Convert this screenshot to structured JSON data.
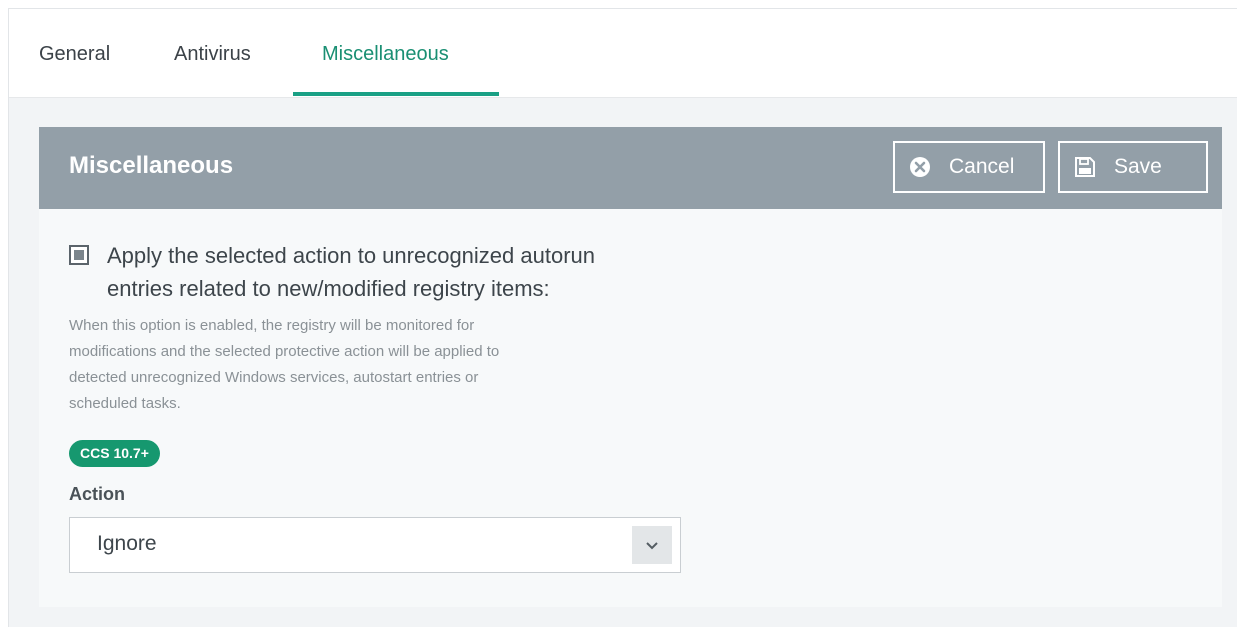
{
  "tabs": [
    {
      "label": "General"
    },
    {
      "label": "Antivirus"
    },
    {
      "label": "Miscellaneous",
      "active": true
    }
  ],
  "panel": {
    "title": "Miscellaneous",
    "cancel_label": "Cancel",
    "save_label": "Save"
  },
  "option": {
    "checked": true,
    "label": "Apply the selected action to unrecognized autorun\nentries related to new/modified registry items:",
    "description": "When this option is enabled, the registry will be monitored for\nmodifications and the selected protective action will be applied to\ndetected unrecognized Windows services, autostart entries or\nscheduled tasks.",
    "badge": "CCS 10.7+"
  },
  "action": {
    "label": "Action",
    "selected": "Ignore"
  },
  "icons": {
    "cancel": "cancel-circle-icon",
    "save": "floppy-disk-icon",
    "dropdown": "chevron-down-icon"
  },
  "colors": {
    "accent": "#1aa085",
    "header": "#939fa8",
    "badge": "#16986f"
  }
}
